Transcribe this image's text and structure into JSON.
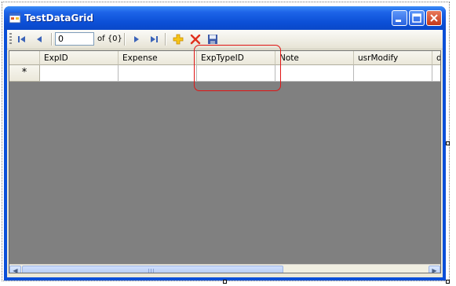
{
  "window": {
    "title": "TestDataGrid"
  },
  "navigator": {
    "position_value": "0",
    "count_label": "of {0}",
    "icons": [
      "move-first-icon",
      "move-previous-icon",
      "move-next-icon",
      "move-last-icon",
      "add-new-icon",
      "delete-icon",
      "save-icon"
    ]
  },
  "grid": {
    "columns": [
      "ExpID",
      "Expense",
      "ExpTypeID",
      "Note",
      "usrModify",
      "dt"
    ],
    "new_row_marker": "*"
  },
  "colors": {
    "titlebar": "#0a4fd8",
    "grid_background": "#808080",
    "highlight": "#e01515"
  }
}
